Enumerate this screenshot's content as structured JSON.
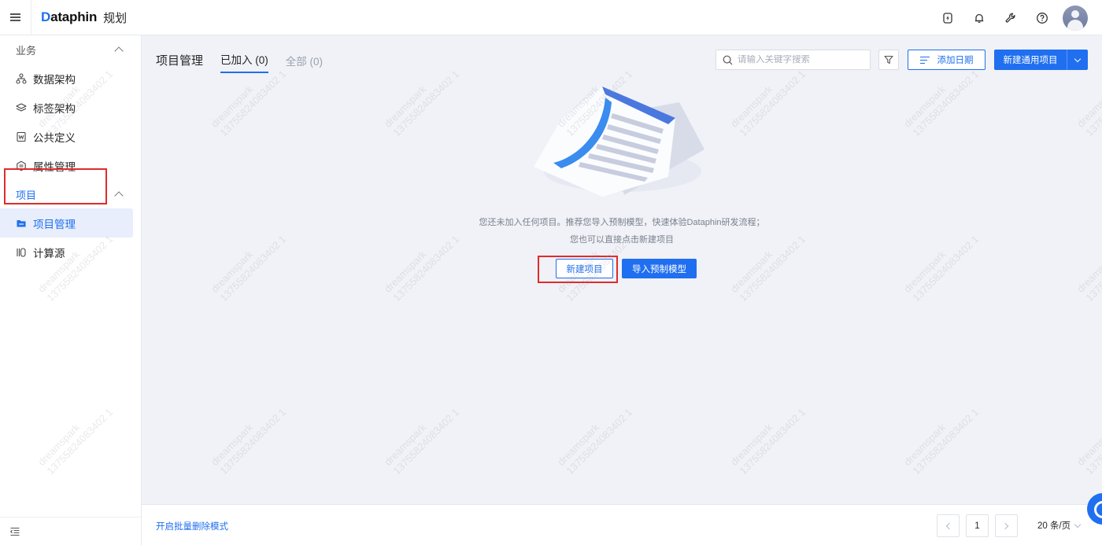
{
  "app": {
    "logo": "Dataphin",
    "module": "规划"
  },
  "topbar": {
    "icons": [
      "lightning-badge-icon",
      "bell-icon",
      "wrench-icon",
      "help-icon",
      "user-avatar"
    ]
  },
  "sidebar": {
    "groups": [
      {
        "label": "业务",
        "items": [
          {
            "label": "数据架构",
            "icon": "architecture-icon"
          },
          {
            "label": "标签架构",
            "icon": "layers-icon"
          },
          {
            "label": "公共定义",
            "icon": "document-w-icon"
          },
          {
            "label": "属性管理",
            "icon": "attribute-icon"
          }
        ]
      },
      {
        "label": "项目",
        "items": [
          {
            "label": "项目管理",
            "icon": "folder-icon",
            "selected": true
          },
          {
            "label": "计算源",
            "icon": "compute-source-icon"
          }
        ]
      }
    ]
  },
  "main": {
    "title": "项目管理",
    "tabs": [
      {
        "label": "已加入 (0)",
        "active": true
      },
      {
        "label": "全部 (0)",
        "active": false
      }
    ],
    "search": {
      "placeholder": "请输入关键字搜索",
      "value": ""
    },
    "add_date_label": "添加日期",
    "new_general_project_label": "新建通用项目",
    "empty": {
      "line1": "您还未加入任何项目。推荐您导入预制模型，快速体验Dataphin研发流程；",
      "line2": "您也可以直接点击新建项目",
      "create_label": "新建项目",
      "import_label": "导入预制模型"
    },
    "watermark": {
      "line1": "dreamspark",
      "line2": "13755824083402 1"
    }
  },
  "footer": {
    "batch_delete_label": "开启批量删除模式",
    "current_page": "1",
    "page_size_label": "20 条/页"
  },
  "colors": {
    "accent": "#1f6ff0",
    "highlight": "#e02b2b",
    "background": "#f0f2f7"
  }
}
